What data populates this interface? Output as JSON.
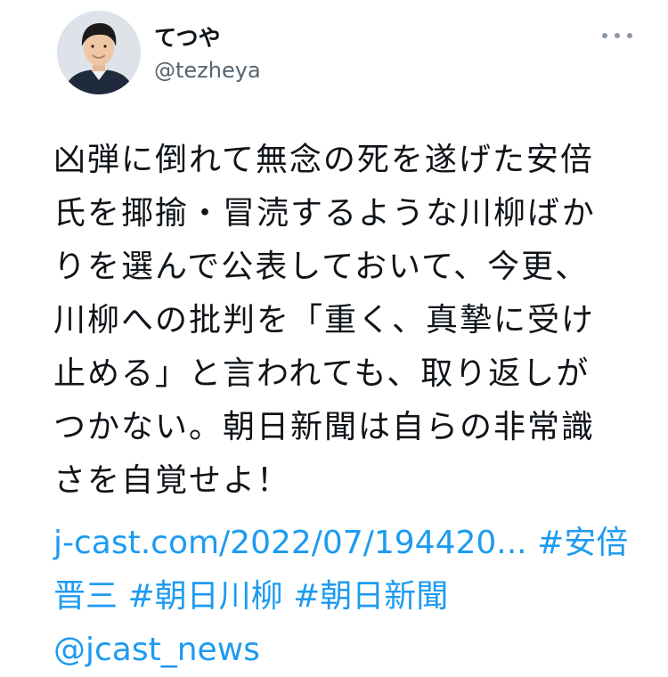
{
  "author": {
    "display_name": "てつや",
    "handle": "@tezheya"
  },
  "icons": {
    "more": "more-options-icon",
    "avatar": "profile-photo"
  },
  "tweet": {
    "lines": [
      "凶弾に倒れて無念の死を遂げた安倍",
      "氏を揶揄・冒涜するような川柳ばか",
      "りを選んで公表しておいて、今更、",
      "川柳への批判を「重く、真摯に受け",
      "止める」と言われても、取り返しが",
      "つかない。朝日新聞は自らの非常識",
      "さを自覚せよ！"
    ]
  },
  "links": {
    "url": "j-cast.com/2022/07/194420...",
    "hashtag_1_part_1": "#安倍",
    "hashtag_1_part_2": "晋三",
    "hashtag_2": "#朝日川柳",
    "hashtag_3": "#朝日新聞",
    "mention": "@jcast_news"
  },
  "colors": {
    "link": "#1d9bf0",
    "text": "#0f1419",
    "secondary": "#536471"
  }
}
